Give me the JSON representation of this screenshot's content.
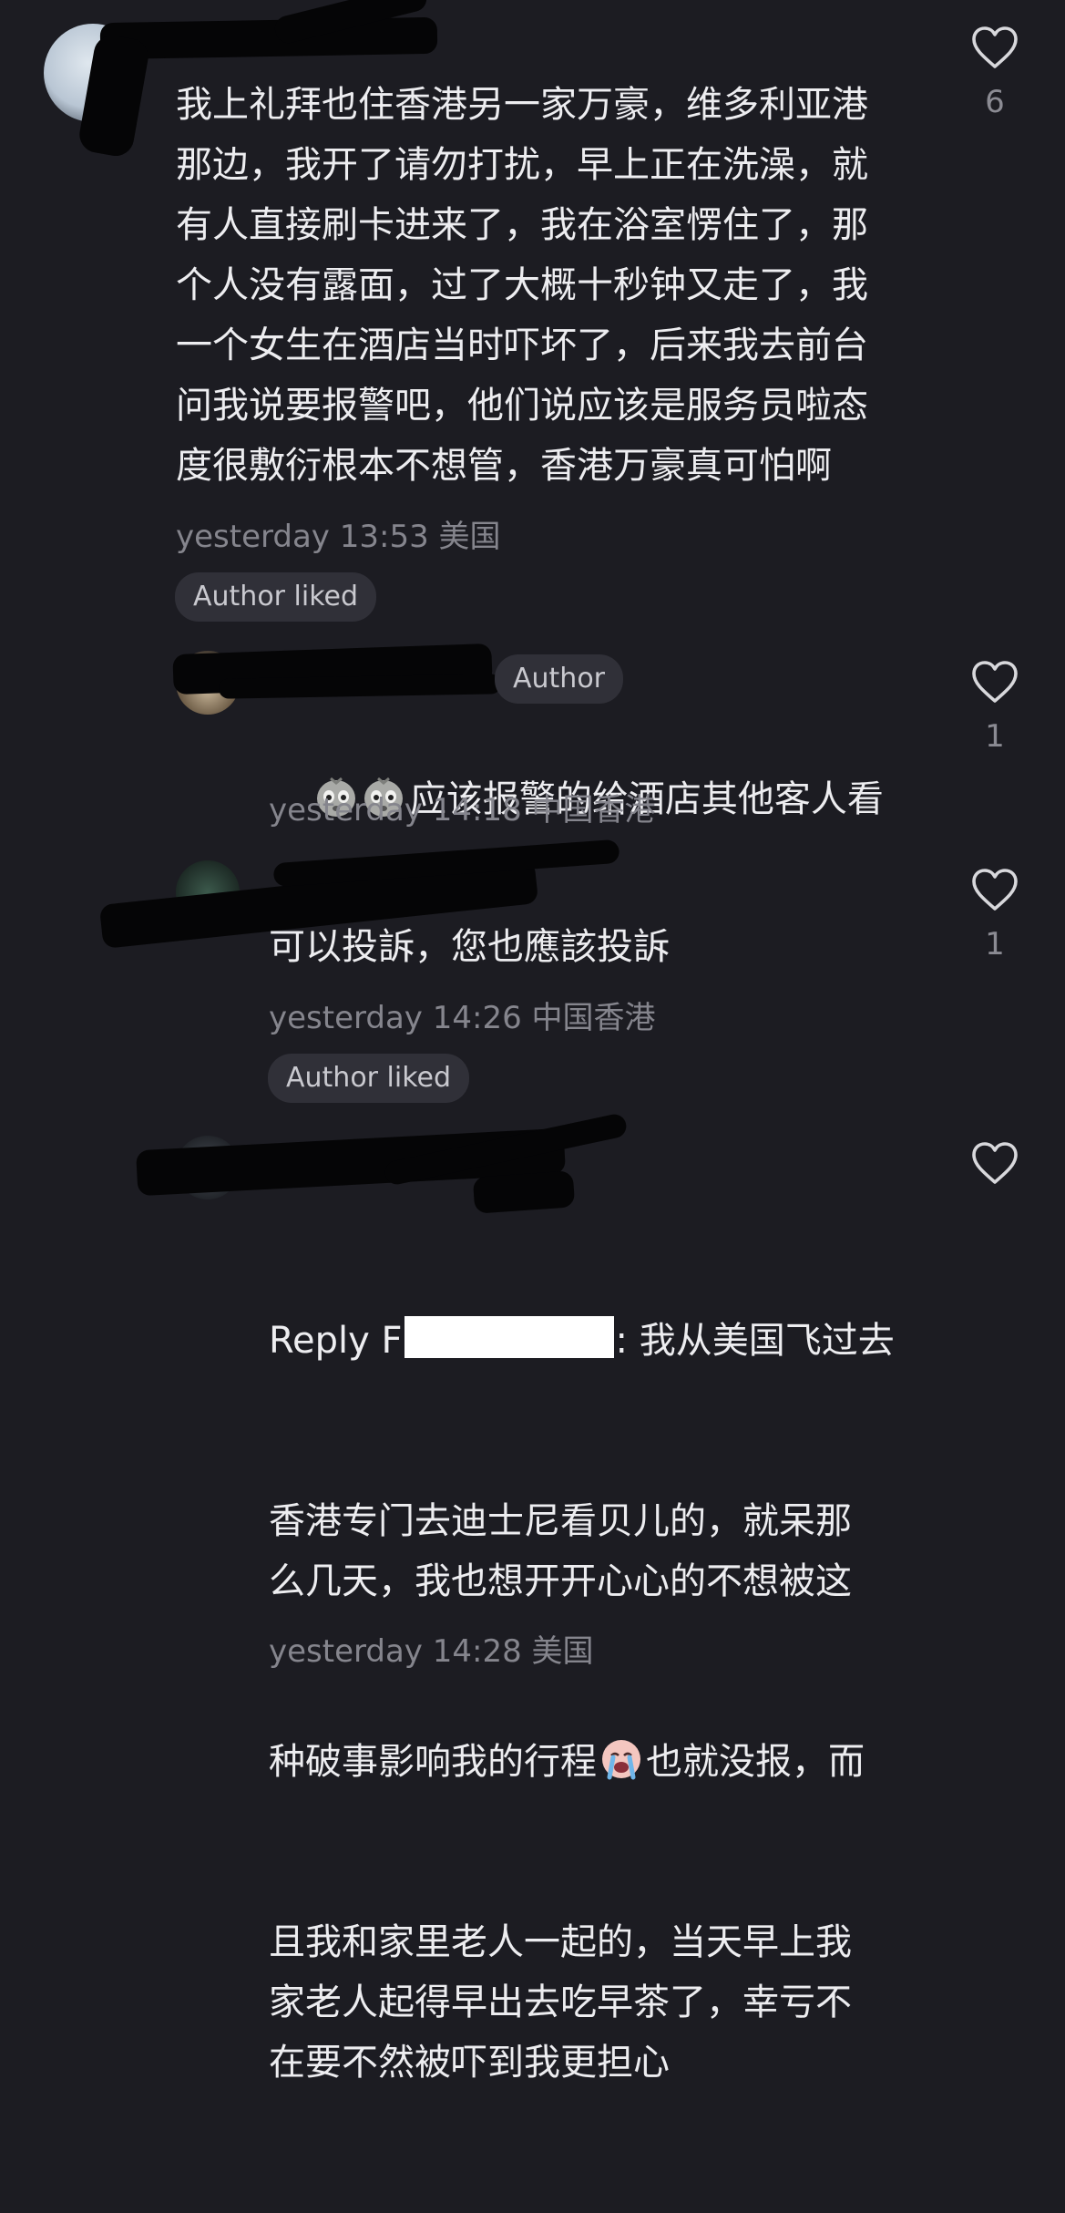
{
  "comments": [
    {
      "text": "我上礼拜也住香港另一家万豪，维多利亚港\n那边，我开了请勿打扰，早上正在洗澡，就\n有人直接刷卡进来了，我在浴室愣住了，那\n个人没有露面，过了大概十秒钟又走了，我\n一个女生在酒店当时吓坏了，后来我去前台\n问我说要报警吧，他们说应该是服务员啦态\n度很敷衍根本不想管，香港万豪真可怕啊",
      "meta": "yesterday 13:53 美国",
      "badge": "Author liked",
      "likes": "6"
    },
    {
      "author_tag": "Author",
      "text": "应该报警的给酒店其他客人看",
      "meta": "yesterday 14:18 中国香港",
      "likes": "1",
      "icons": [
        "crying-face-icon",
        "crying-face-icon"
      ]
    },
    {
      "text": "可以投訴，您也應該投訴",
      "meta": "yesterday 14:26 中国香港",
      "badge": "Author liked",
      "likes": "1"
    },
    {
      "reply_prefix": "Reply F",
      "text_line1": ": 我从美国飞过去",
      "text_line2": "香港专门去迪士尼看贝儿的，就呆那\n么几天，我也想开开心心的不想被这",
      "text_before_emoji": "种破事影响我的行程",
      "text_after_emoji": "也就没报，而",
      "text_rest": "且我和家里老人一起的，当天早上我\n家老人起得早出去吃早茶了，幸亏不\n在要不然被吓到我更担心",
      "meta": "yesterday 14:28 美国",
      "icons": [
        "loudly-crying-face-icon"
      ]
    }
  ],
  "colors": {
    "background": "#1c1c22",
    "text": "#ededf0",
    "meta": "#85858d",
    "badge_bg": "#303038"
  }
}
